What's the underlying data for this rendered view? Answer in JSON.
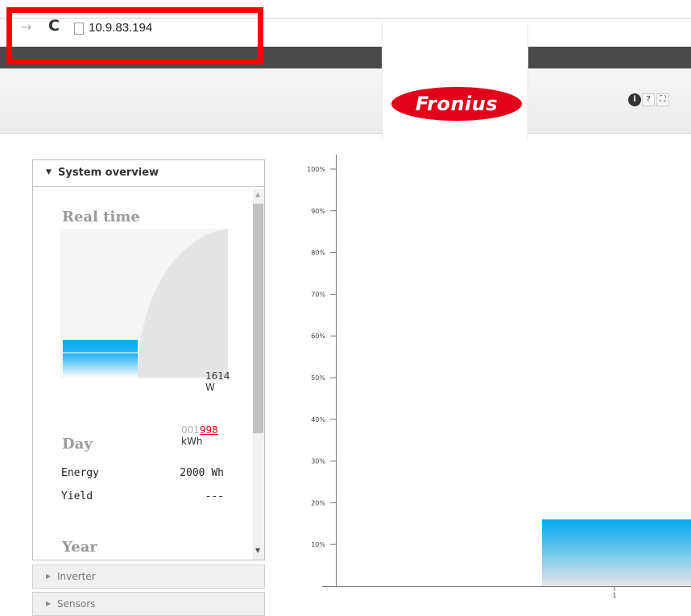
{
  "browser": {
    "forward_icon": "arrow-right-icon",
    "reload_icon": "reload-icon",
    "page_icon": "page-icon",
    "url": "10.9.83.194"
  },
  "header": {
    "logo_text": "Fronius",
    "brand_color": "#e2001a",
    "icons": [
      "info-icon",
      "help-icon",
      "fullscreen-icon"
    ],
    "help_label": "?",
    "info_label": "i",
    "fullscreen_label": "⛶"
  },
  "sidebar": {
    "panel_title": "System overview",
    "realtime": {
      "title": "Real time",
      "power": "1614 W",
      "energy_gray": "001",
      "energy_red": "998",
      "energy_unit": "kWh"
    },
    "day": {
      "title": "Day",
      "rows": [
        {
          "label": "Energy",
          "value": "2000 Wh"
        },
        {
          "label": "Yield",
          "value": "---"
        }
      ]
    },
    "year": {
      "title": "Year"
    },
    "collapsed_panels": [
      "Inverter",
      "Sensors"
    ]
  },
  "chart_data": {
    "type": "bar",
    "categories": [
      "1"
    ],
    "values": [
      16
    ],
    "y_ticks": [
      "10%",
      "20%",
      "30%",
      "40%",
      "50%",
      "60%",
      "70%",
      "80%",
      "90%",
      "100%"
    ],
    "ylim": [
      0,
      100
    ],
    "bar_color_top": "#00aaf0",
    "bar_color_bottom": "#e6e6e6"
  }
}
